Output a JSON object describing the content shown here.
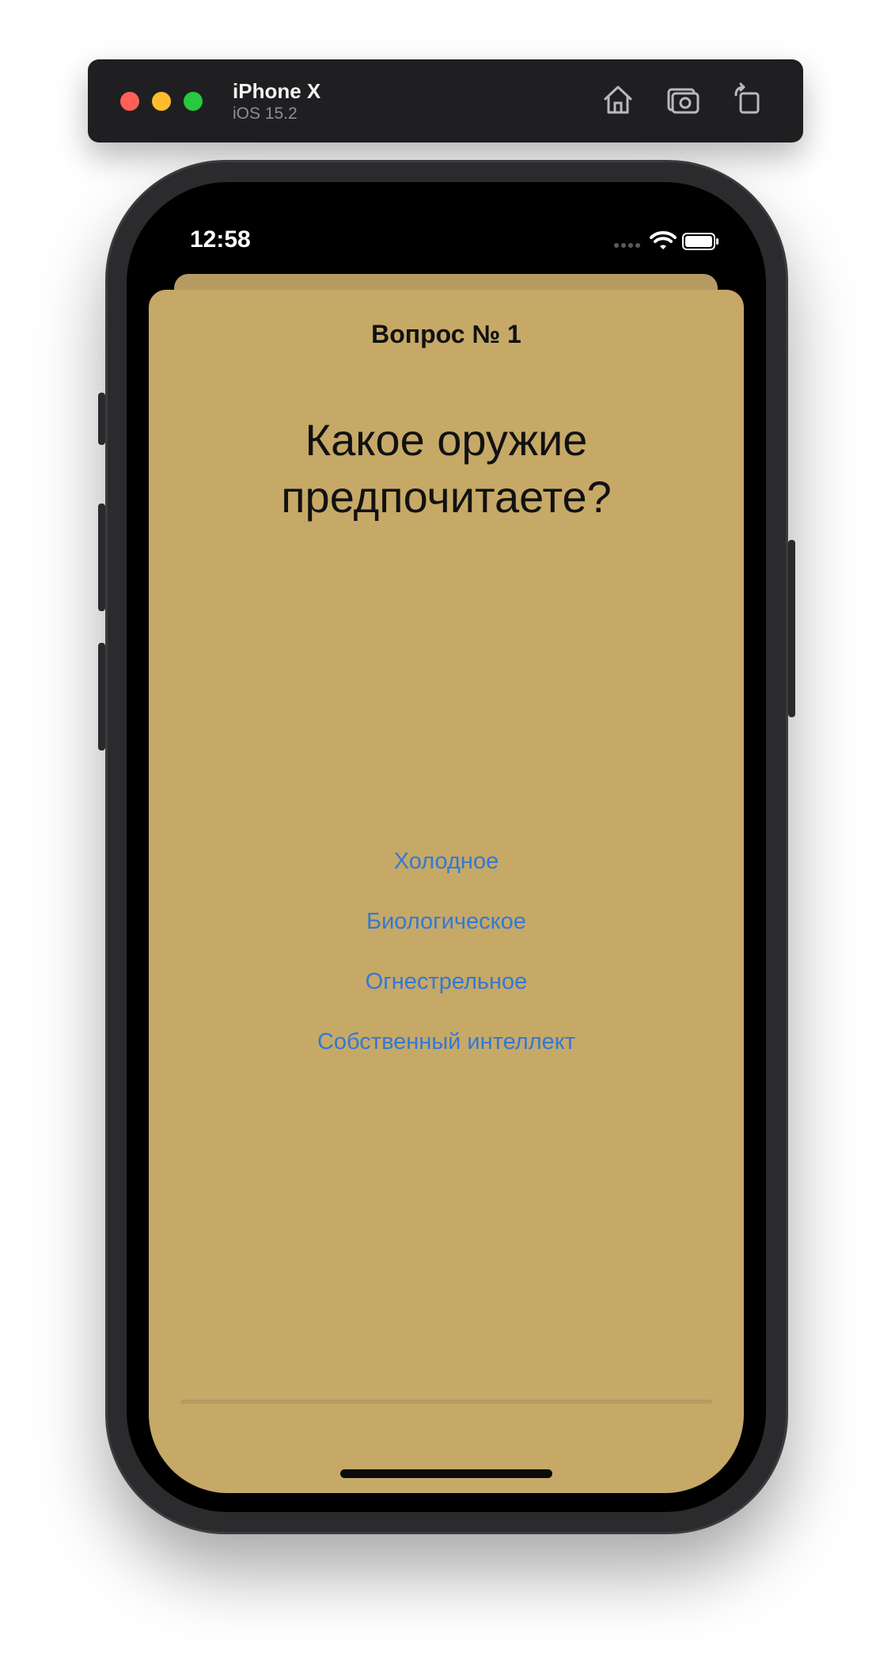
{
  "simulator": {
    "device_name": "iPhone X",
    "os_version": "iOS 15.2",
    "buttons": [
      "home-icon",
      "screenshot-icon",
      "rotate-icon"
    ]
  },
  "status_bar": {
    "time": "12:58",
    "icons": [
      "signal-dots-icon",
      "wifi-icon",
      "battery-icon"
    ]
  },
  "quiz": {
    "question_number": "Вопрос № 1",
    "question": "Какое оружие предпочитаете?",
    "answers": [
      "Холодное",
      "Биологическое",
      "Огнестрельное",
      "Собственный интеллект"
    ]
  },
  "colors": {
    "card_background": "#c6a967",
    "answer_link": "#3478d4",
    "card_back_layer": "#b59a61"
  }
}
